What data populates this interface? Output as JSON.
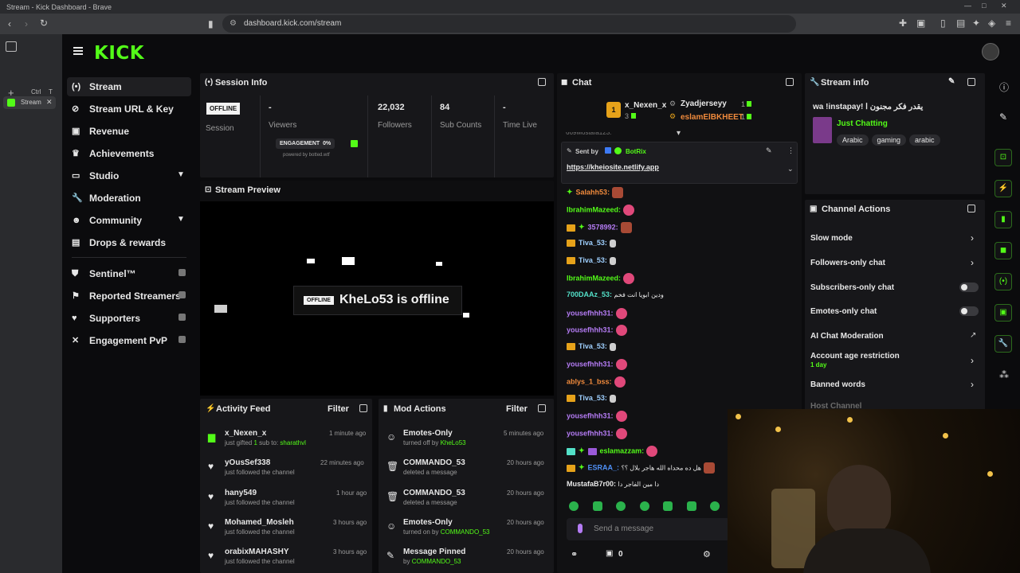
{
  "browser": {
    "window_title": "Stream - Kick Dashboard - Brave",
    "url": "dashboard.kick.com/stream",
    "tab_label": "Stream",
    "ctrl_hint": "Ctrl",
    "ctrl_key": "T"
  },
  "brand": {
    "logo": "KICK",
    "accent": "#53fc18"
  },
  "nav": {
    "items": [
      {
        "label": "Stream",
        "icon": "broadcast-icon"
      },
      {
        "label": "Stream URL & Key",
        "icon": "link-icon"
      },
      {
        "label": "Revenue",
        "icon": "revenue-icon"
      },
      {
        "label": "Achievements",
        "icon": "trophy-icon"
      },
      {
        "label": "Studio",
        "icon": "studio-icon"
      },
      {
        "label": "Moderation",
        "icon": "wrench-icon"
      },
      {
        "label": "Community",
        "icon": "community-icon"
      },
      {
        "label": "Drops & rewards",
        "icon": "drops-icon"
      },
      {
        "label": "Sentinel™",
        "icon": "shield-icon"
      },
      {
        "label": "Reported Streamers",
        "icon": "flag-icon"
      },
      {
        "label": "Supporters",
        "icon": "heart-icon"
      },
      {
        "label": "Engagement PvP",
        "icon": "swords-icon"
      }
    ]
  },
  "session": {
    "title": "Session Info",
    "status_badge": "OFFLINE",
    "session_label": "Session",
    "viewers_value": "-",
    "viewers_label": "Viewers",
    "followers_value": "22,032",
    "followers_label": "Followers",
    "subs_value": "84",
    "subs_label": "Sub Counts",
    "time_value": "-",
    "time_label": "Time Live",
    "engagement_label": "ENGAGEMENT",
    "engagement_value": "0%",
    "powered_by": "powered by botted.wtf"
  },
  "preview": {
    "title": "Stream Preview",
    "badge": "OFFLINE",
    "message": "KheLo53 is offline"
  },
  "activity": {
    "title": "Activity Feed",
    "filter": "Filter",
    "items": [
      {
        "name": "x_Nexen_x",
        "prefix": "just gifted",
        "count": "1",
        "mid": "sub to:",
        "target": "sharathvl",
        "time": "1 minute ago"
      },
      {
        "name": "yOusSef338",
        "desc": "just followed the channel",
        "time": "22 minutes ago"
      },
      {
        "name": "hany549",
        "desc": "just followed the channel",
        "time": "1 hour ago"
      },
      {
        "name": "Mohamed_Mosleh",
        "desc": "just followed the channel",
        "time": "3 hours ago"
      },
      {
        "name": "orabixMAHASHY",
        "desc": "just followed the channel",
        "time": "3 hours ago"
      }
    ]
  },
  "mod": {
    "title": "Mod Actions",
    "filter": "Filter",
    "items": [
      {
        "name": "Emotes-Only",
        "desc": "turned off by",
        "by": "KheLo53",
        "time": "5 minutes ago"
      },
      {
        "name": "COMMANDO_53",
        "desc": "deleted a message",
        "time": "20 hours ago"
      },
      {
        "name": "COMMANDO_53",
        "desc": "deleted a message",
        "time": "20 hours ago"
      },
      {
        "name": "Emotes-Only",
        "desc": "turned on by",
        "by": "COMMANDO_53",
        "time": "20 hours ago"
      },
      {
        "name": "Message Pinned",
        "desc": "by",
        "by": "COMMANDO_53",
        "time": "20 hours ago"
      }
    ]
  },
  "chat": {
    "title": "Chat",
    "top_gifters": [
      {
        "rank": "1",
        "name": "x_Nexen_x",
        "count": "3"
      },
      {
        "name": "Zyadjerseyy",
        "count": "1"
      },
      {
        "name": "eslamElBKHEET",
        "count": "1"
      }
    ],
    "truncated_line": "669Mostafa123:",
    "pinned": {
      "sent_by": "Sent by",
      "user": "BotRix",
      "link": "https://kheiosite.netlify.app"
    },
    "messages": [
      {
        "user": "Salahh53:",
        "color": "#f08a3c"
      },
      {
        "user": "IbrahimMazeed:",
        "color": "#53fc18"
      },
      {
        "user": "3578992:",
        "color": "#b57cf5"
      },
      {
        "user": "Tiva_53:",
        "color": "#9fd0ff"
      },
      {
        "user": "Tiva_53:",
        "color": "#9fd0ff"
      },
      {
        "user": "IbrahimMazeed:",
        "color": "#53fc18"
      },
      {
        "user": "700DAAz_53:",
        "color": "#53e0c8",
        "text": "ودين ابويا انت فخم"
      },
      {
        "user": "yousefhhh31:",
        "color": "#b57cf5"
      },
      {
        "user": "yousefhhh31:",
        "color": "#b57cf5"
      },
      {
        "user": "Tiva_53:",
        "color": "#9fd0ff"
      },
      {
        "user": "yousefhhh31:",
        "color": "#b57cf5"
      },
      {
        "user": "ablys_1_bss:",
        "color": "#f08a3c"
      },
      {
        "user": "Tiva_53:",
        "color": "#9fd0ff"
      },
      {
        "user": "yousefhhh31:",
        "color": "#b57cf5"
      },
      {
        "user": "yousefhhh31:",
        "color": "#b57cf5"
      },
      {
        "user": "eslamazzam:",
        "color": "#53fc18"
      },
      {
        "user": "ESRAA_:",
        "color": "#4f8ff5",
        "text": "هل ده محداه الله هاجر بلال ؟؟"
      },
      {
        "user": "MustafaB7r00:",
        "color": "#e8e8e8",
        "text": "دا مين الفاجر دا"
      }
    ],
    "input_placeholder": "Send a message",
    "points": "0"
  },
  "stream_info": {
    "title": "Stream info",
    "stream_title": "wa !instapay! يقدر فكر مجنون ا",
    "category": "Just Chatting",
    "tags": [
      "Arabic",
      "gaming",
      "arabic"
    ]
  },
  "channel_actions": {
    "title": "Channel Actions",
    "slow_mode": "Slow mode",
    "followers_only": "Followers-only chat",
    "subscribers_only": "Subscribers-only chat",
    "emotes_only": "Emotes-only chat",
    "ai_moderation": "AI Chat Moderation",
    "account_age": "Account age restriction",
    "account_age_value": "1 day",
    "banned_words": "Banned words",
    "host_channel": "Host Channel"
  }
}
